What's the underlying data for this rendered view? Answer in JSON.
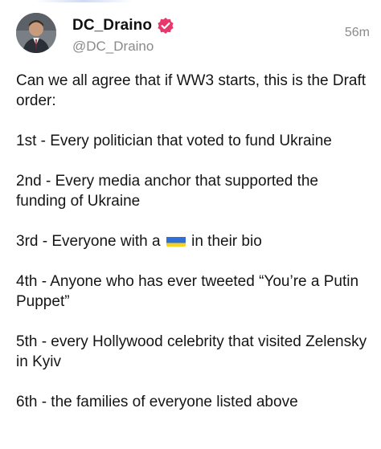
{
  "post": {
    "author": {
      "display_name": "DC_Draino",
      "handle": "@DC_Draino",
      "verified_badge_color": "#e8386b"
    },
    "timestamp": "56m",
    "intro": "Can we all agree that if WW3 starts, this is the Draft order:",
    "items": {
      "first": "1st - Every politician that voted to fund Ukraine",
      "second": "2nd - Every media anchor that supported the funding of Ukraine",
      "third_before": "3rd - Everyone with a",
      "third_after": "in their bio",
      "third_icon": "ukraine-flag-icon",
      "fourth": "4th - Anyone who has ever tweeted “You’re a Putin Puppet”",
      "fifth": "5th - every Hollywood celebrity that visited Zelensky in Kyiv",
      "sixth": "6th - the families of everyone listed above"
    }
  },
  "colors": {
    "text_primary": "#111111",
    "text_secondary": "#8a8a8a",
    "flag_blue": "#2f6fd6",
    "flag_yellow": "#f7d21e"
  }
}
